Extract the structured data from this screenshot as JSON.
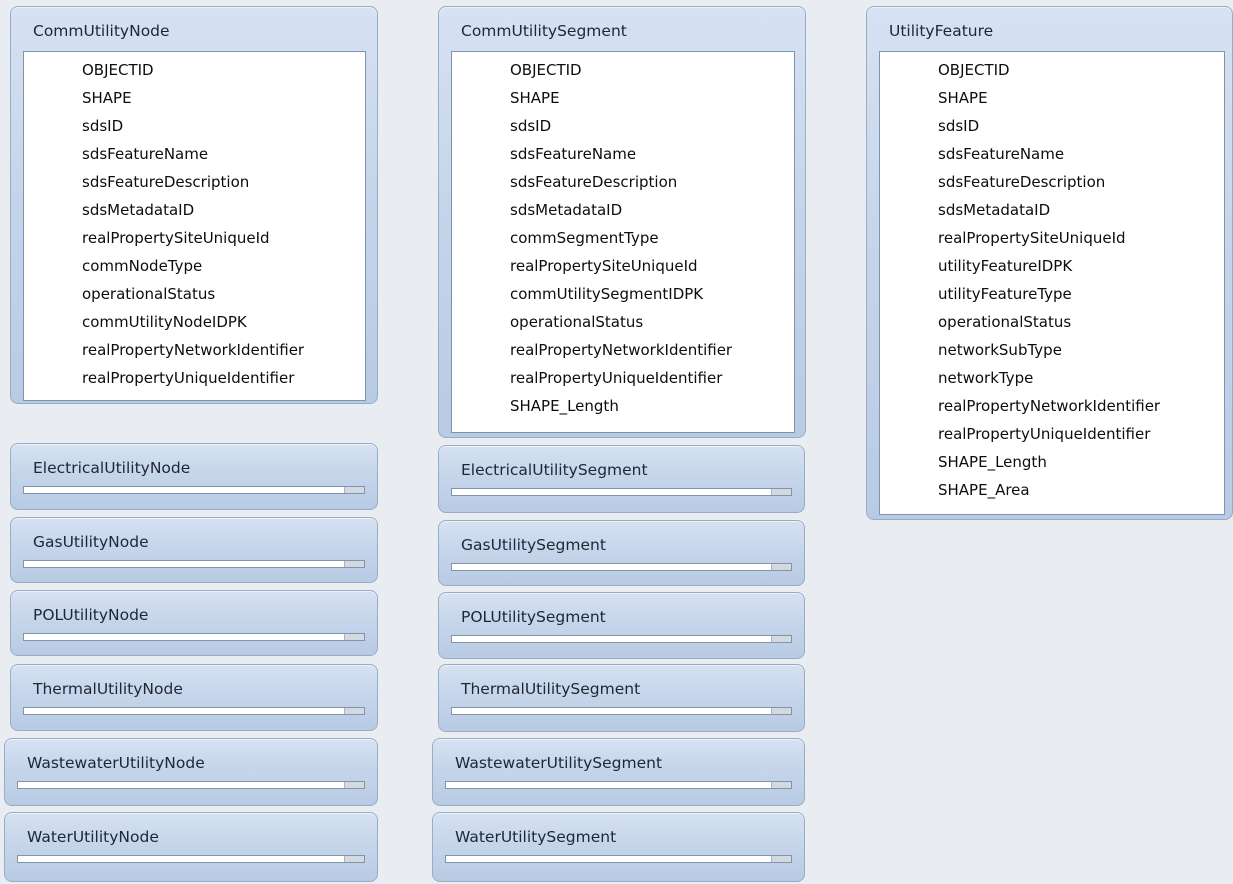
{
  "expanded_tables": [
    {
      "name": "CommUtilityNode",
      "fields": [
        "OBJECTID",
        "SHAPE",
        "sdsID",
        "sdsFeatureName",
        "sdsFeatureDescription",
        "sdsMetadataID",
        "realPropertySiteUniqueId",
        "commNodeType",
        "operationalStatus",
        "commUtilityNodeIDPK",
        "realPropertyNetworkIdentifier",
        "realPropertyUniqueIdentifier"
      ]
    },
    {
      "name": "CommUtilitySegment",
      "fields": [
        "OBJECTID",
        "SHAPE",
        "sdsID",
        "sdsFeatureName",
        "sdsFeatureDescription",
        "sdsMetadataID",
        "commSegmentType",
        "realPropertySiteUniqueId",
        "commUtilitySegmentIDPK",
        "operationalStatus",
        "realPropertyNetworkIdentifier",
        "realPropertyUniqueIdentifier",
        "SHAPE_Length"
      ]
    },
    {
      "name": "UtilityFeature",
      "fields": [
        "OBJECTID",
        "SHAPE",
        "sdsID",
        "sdsFeatureName",
        "sdsFeatureDescription",
        "sdsMetadataID",
        "realPropertySiteUniqueId",
        "utilityFeatureIDPK",
        "utilityFeatureType",
        "operationalStatus",
        "networkSubType",
        "networkType",
        "realPropertyNetworkIdentifier",
        "realPropertyUniqueIdentifier",
        "SHAPE_Length",
        "SHAPE_Area"
      ]
    }
  ],
  "collapsed_node_tables": [
    "ElectricalUtilityNode",
    "GasUtilityNode",
    "POLUtilityNode",
    "ThermalUtilityNode",
    "WastewaterUtilityNode",
    "WaterUtilityNode"
  ],
  "collapsed_segment_tables": [
    "ElectricalUtilitySegment",
    "GasUtilitySegment",
    "POLUtilitySegment",
    "ThermalUtilitySegment",
    "WastewaterUtilitySegment",
    "WaterUtilitySegment"
  ]
}
